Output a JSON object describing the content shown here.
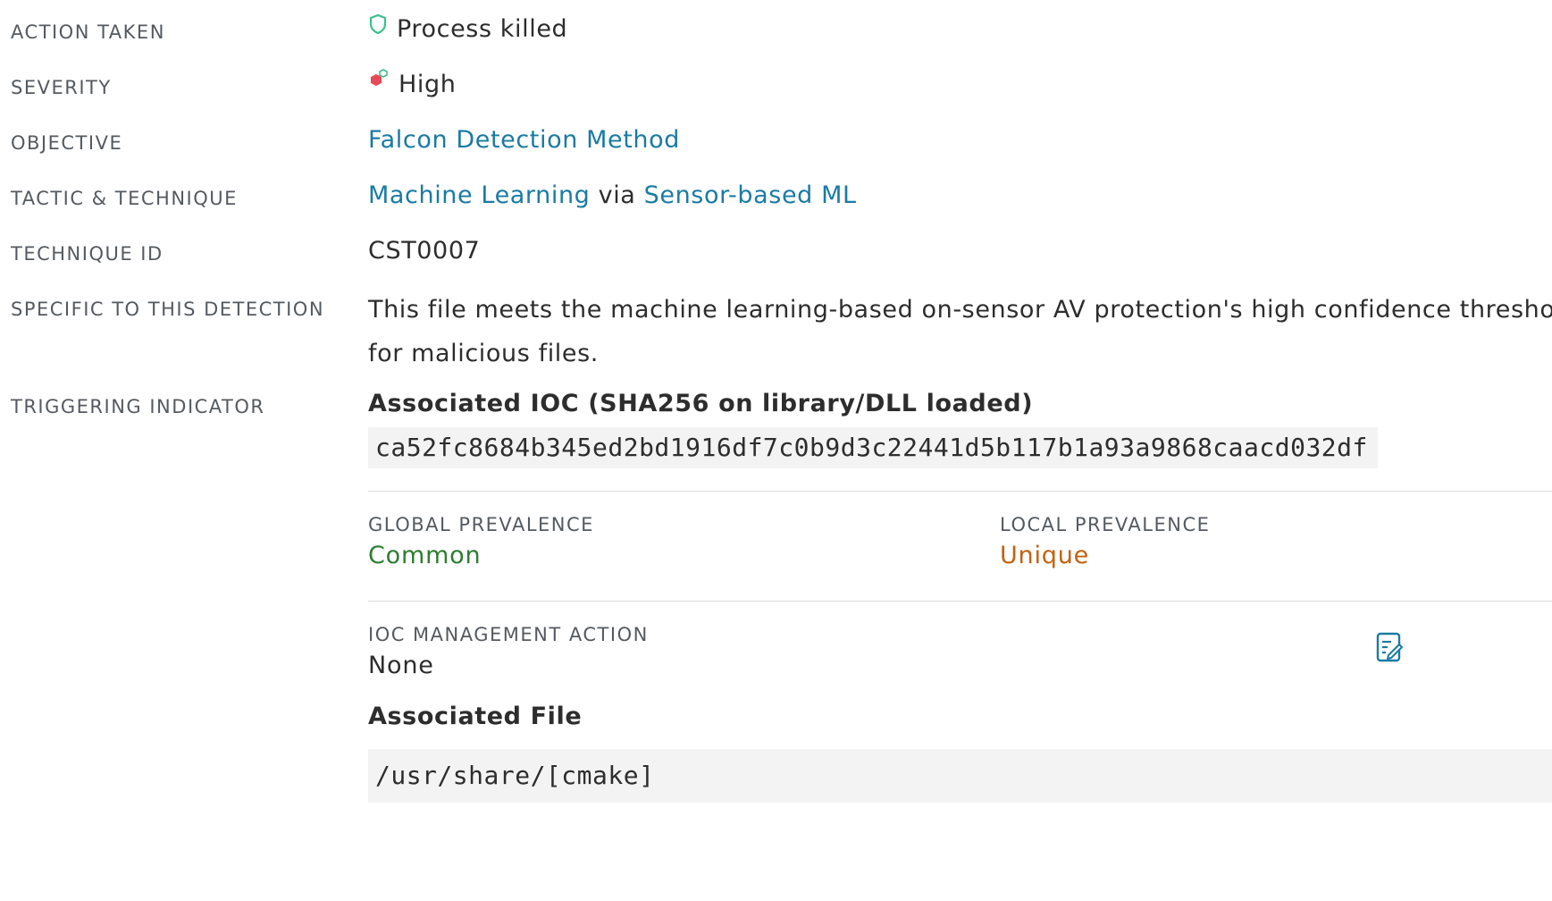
{
  "colors": {
    "link": "#1a7ba3",
    "common": "#2e7d32",
    "unique": "#c2620f",
    "shield": "#3cbf8a",
    "severity_high": "#e84a55"
  },
  "rows": {
    "action_taken": {
      "label": "ACTION TAKEN",
      "value": "Process killed",
      "icon": "shield-icon"
    },
    "severity": {
      "label": "SEVERITY",
      "value": "High",
      "icon": "severity-high-icon"
    },
    "objective": {
      "label": "OBJECTIVE",
      "value": "Falcon Detection Method"
    },
    "tactic": {
      "label": "TACTIC & TECHNIQUE",
      "tactic": "Machine Learning",
      "via": "via",
      "technique": "Sensor-based ML"
    },
    "technique_id": {
      "label": "TECHNIQUE ID",
      "value": "CST0007"
    },
    "specific": {
      "label": "SPECIFIC TO THIS DETECTION",
      "value": "This file meets the machine learning-based on-sensor AV protection's high confidence threshold for malicious files."
    },
    "triggering": {
      "label": "TRIGGERING INDICATOR"
    }
  },
  "indicator": {
    "ioc_title": "Associated IOC (SHA256 on library/DLL loaded)",
    "hash": "ca52fc8684b345ed2bd1916df7c0b9d3c22441d5b117b1a93a9868caacd032df",
    "global_prevalence_label": "GLOBAL PREVALENCE",
    "global_prevalence_value": "Common",
    "local_prevalence_label": "LOCAL PREVALENCE",
    "local_prevalence_value": "Unique",
    "ioc_mgmt_label": "IOC MANAGEMENT ACTION",
    "ioc_mgmt_value": "None",
    "edit_icon": "edit-icon",
    "file_title": "Associated File",
    "file_path": "/usr/share/[cmake]"
  }
}
